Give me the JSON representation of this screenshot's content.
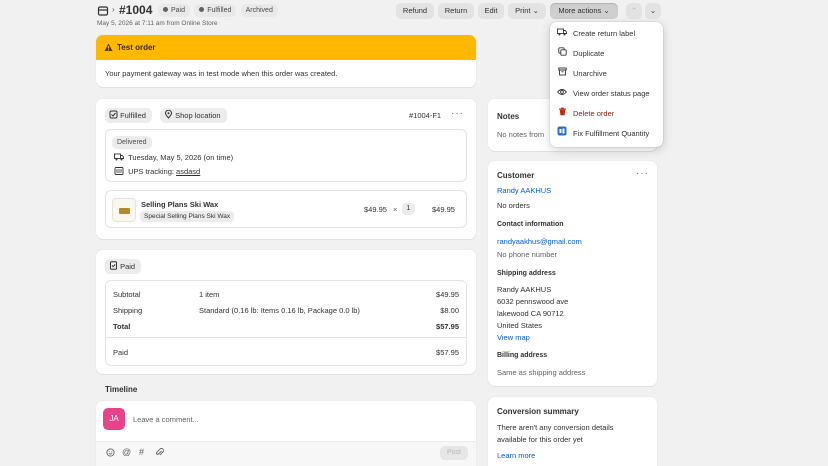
{
  "header": {
    "order_number": "#1004",
    "badges": [
      {
        "label": "Paid",
        "dot": "full"
      },
      {
        "label": "Fulfilled",
        "dot": "full"
      },
      {
        "label": "Archived",
        "dot": "none"
      }
    ],
    "subtitle": "May 5, 2026 at 7:11 am from Online Store",
    "buttons": {
      "refund": "Refund",
      "return": "Return",
      "edit": "Edit",
      "print": "Print",
      "more_actions": "More actions"
    }
  },
  "test_order": {
    "title": "Test order",
    "message": "Your payment gateway was in test mode when this order was created."
  },
  "fulfillment": {
    "status_label": "Fulfilled",
    "location_label": "Shop location",
    "fulfillment_id": "#1004-F1",
    "delivery_badge": "Delivered",
    "delivery_date": "Tuesday, May 5, 2026 (on time)",
    "tracking_prefix": "UPS tracking:",
    "tracking_number": "asdasd",
    "item": {
      "name": "Selling Plans Ski Wax",
      "variant": "Special Selling Plans Ski Wax",
      "unit_price": "$49.95",
      "times": "×",
      "quantity": "1",
      "total": "$49.95"
    }
  },
  "payment": {
    "status_label": "Paid",
    "rows": [
      {
        "label": "Subtotal",
        "detail": "1 item",
        "amount": "$49.95"
      },
      {
        "label": "Shipping",
        "detail": "Standard (0.16 lb: Items 0.16 lb, Package 0.0 lb)",
        "amount": "$8.00"
      },
      {
        "label": "Total",
        "detail": "",
        "amount": "$57.95"
      }
    ],
    "paid_label": "Paid",
    "paid_amount": "$57.95"
  },
  "timeline": {
    "title": "Timeline",
    "avatar_initials": "JA",
    "comment_placeholder": "Leave a comment...",
    "post_label": "Post"
  },
  "notes": {
    "title": "Notes",
    "text": "No notes from"
  },
  "customer": {
    "title": "Customer",
    "name": "Randy AAKHUS",
    "orders": "No orders",
    "contact_title": "Contact information",
    "email": "randyaakhus@gmail.com",
    "phone": "No phone number",
    "shipping_title": "Shipping address",
    "shipping_lines": [
      "Randy AAKHUS",
      "6032 pennswood ave",
      "lakewood CA 90712",
      "United States"
    ],
    "view_map": "View map",
    "billing_title": "Billing address",
    "billing_text": "Same as shipping address"
  },
  "conversion": {
    "title": "Conversion summary",
    "text_line1": "There aren't any conversion details",
    "text_line2": "available for this order yet",
    "learn_more": "Learn more"
  },
  "more_actions_menu": {
    "items": [
      {
        "label": "Create return label",
        "icon": "truck-icon"
      },
      {
        "label": "Duplicate",
        "icon": "duplicate-icon"
      },
      {
        "label": "Unarchive",
        "icon": "archive-icon"
      },
      {
        "label": "View order status page",
        "icon": "eye-icon"
      },
      {
        "label": "Delete order",
        "icon": "trash-icon",
        "danger": true
      },
      {
        "label": "Fix Fulfillment Quantity",
        "icon": "app-icon"
      }
    ]
  },
  "colors": {
    "warning": "#ffb800",
    "link": "#005bd3",
    "danger": "#8e1f0b",
    "avatar": "#e8438a"
  }
}
